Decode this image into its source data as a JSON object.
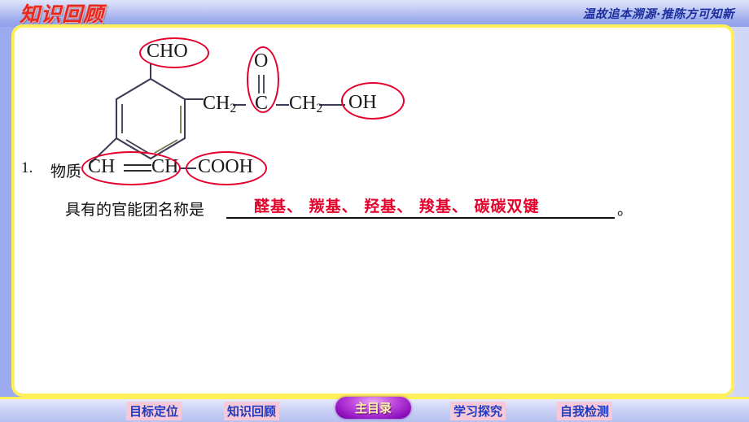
{
  "header": {
    "title": "知识回顾",
    "subtitle": "温故追本溯源·推陈方可知新"
  },
  "structure": {
    "label_cho": "CHO",
    "label_o": "O",
    "label_c": "C",
    "label_ch2_a": "CH2",
    "label_ch2_b": "CH2",
    "label_oh": "OH",
    "label_ch_left": "CH",
    "label_ch_right": "CH",
    "label_cooh": "COOH",
    "circle_names": [
      "cho-circle",
      "carbonyl-circle",
      "hydroxyl-circle",
      "alkene-circle",
      "carboxyl-circle"
    ],
    "circle_color": "#e4002b"
  },
  "question": {
    "number": "1.",
    "stem": "物质",
    "line2": "具有的官能团名称是",
    "answer": "醛基、 羰基、 羟基、 羧基、 碳碳双键",
    "period": "。",
    "answer_color": "#e4002b"
  },
  "footer": {
    "items": [
      {
        "label": "目标定位"
      },
      {
        "label": "知识回顾"
      },
      {
        "label": "主目录"
      },
      {
        "label": "学习探究"
      },
      {
        "label": "自我检测"
      }
    ],
    "accent": "#8e0fbd",
    "border": "#fff05a"
  }
}
